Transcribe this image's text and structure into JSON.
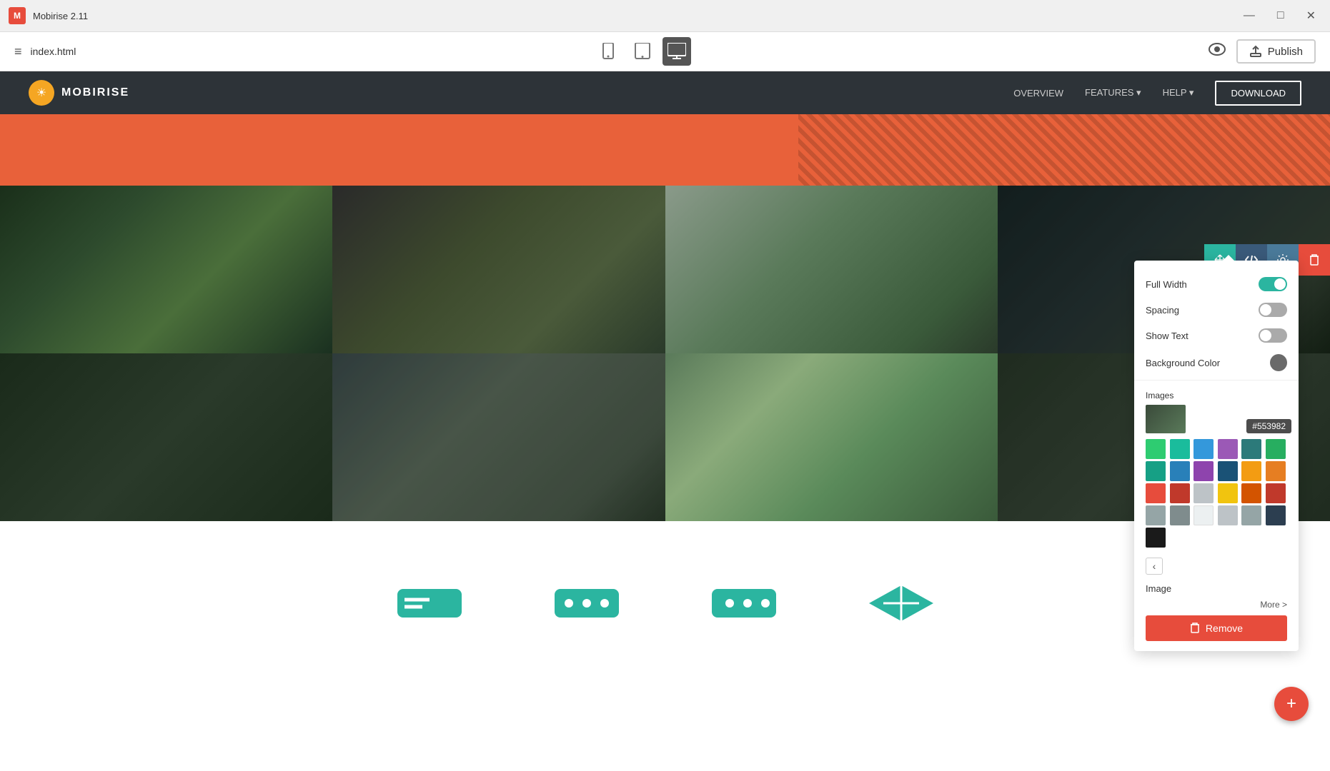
{
  "titlebar": {
    "logo": "M",
    "title": "Mobirise 2.11",
    "minimize": "—",
    "maximize": "□",
    "close": "✕"
  },
  "toolbar": {
    "hamburger": "≡",
    "filename": "index.html",
    "devices": [
      {
        "id": "mobile",
        "icon": "📱",
        "label": "mobile"
      },
      {
        "id": "tablet",
        "icon": "📱",
        "label": "tablet"
      },
      {
        "id": "desktop",
        "icon": "🖥",
        "label": "desktop",
        "active": true
      }
    ],
    "preview_label": "👁",
    "publish_label": "Publish"
  },
  "nav": {
    "logo_text": "MOBIRISE",
    "links": [
      "OVERVIEW",
      "FEATURES ▾",
      "HELP ▾"
    ],
    "download_label": "DOWNLOAD"
  },
  "settings": {
    "full_width_label": "Full Width",
    "full_width_value": true,
    "spacing_label": "Spacing",
    "spacing_value": false,
    "show_text_label": "Show Text",
    "show_text_value": false,
    "bg_color_label": "Background Color",
    "images_label": "Images",
    "image_label": "Image",
    "more_label": "More >",
    "remove_label": "Remove",
    "color_hex": "#553982",
    "palette": [
      "#2ecc71",
      "#1abc9c",
      "#3498db",
      "#9b59b6",
      "#2c7a7a",
      "#27ae60",
      "#16a085",
      "#2980b9",
      "#8e44ad",
      "#1a5276",
      "#f39c12",
      "#e67e22",
      "#e74c3c",
      "#c0392b",
      "#bdc3c7",
      "#f1c40f",
      "#d35400",
      "#c0392b",
      "#95a5a6",
      "#7f8c8d",
      "#ecf0f1",
      "#bdc3c7",
      "#95a5a6",
      "#2c3e50",
      "#1a1a1a"
    ]
  },
  "block_actions": {
    "move_icon": "↕",
    "code_icon": "</>",
    "settings_icon": "⚙",
    "delete_icon": "🗑"
  },
  "fab": {
    "icon": "+"
  }
}
